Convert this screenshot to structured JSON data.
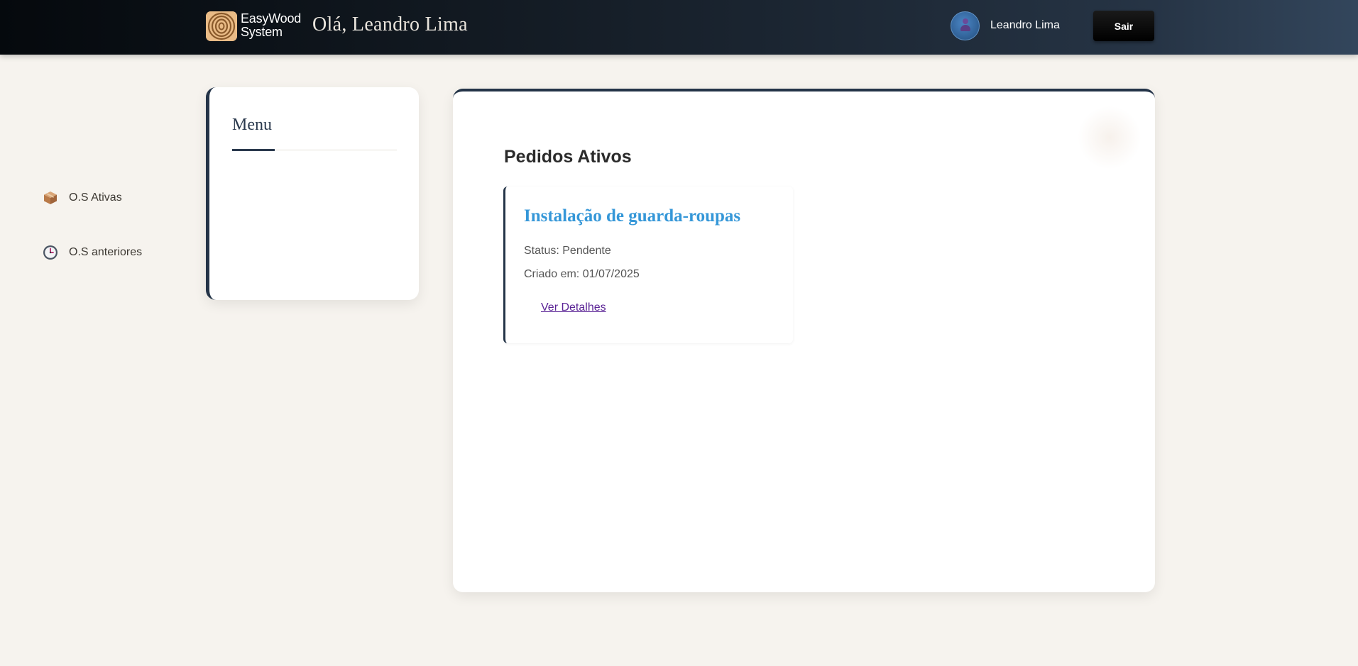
{
  "header": {
    "brand_line1": "EasyWood",
    "brand_line2": "System",
    "greeting": "Olá, Leandro Lima",
    "user_name": "Leandro Lima",
    "logout_label": "Sair"
  },
  "sidebar": {
    "title": "Menu",
    "items": [
      {
        "label": "O.S Ativas",
        "icon": "package-icon"
      },
      {
        "label": "O.S anteriores",
        "icon": "clock-icon"
      }
    ]
  },
  "main": {
    "section_title": "Pedidos Ativos",
    "orders": [
      {
        "title": "Instalação de guarda-roupas",
        "status": "Status: Pendente",
        "created": "Criado em: 01/07/2025",
        "link_label": "Ver Detalhes"
      }
    ]
  },
  "colors": {
    "header_dark": "#05090d",
    "header_light": "#33465c",
    "accent_navy": "#243448",
    "title_blue": "#3597d8",
    "link_purple": "#5b2496",
    "background": "#f6f3ee"
  }
}
